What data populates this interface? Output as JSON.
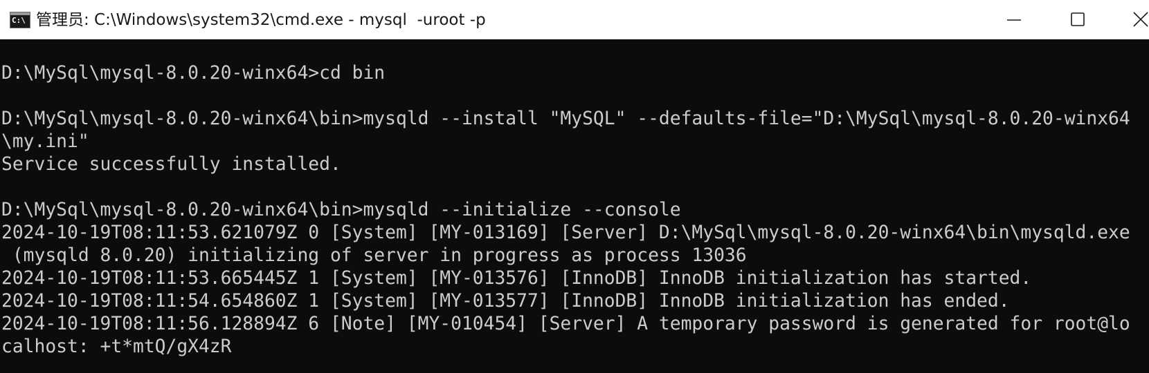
{
  "window": {
    "title": "管理员: C:\\Windows\\system32\\cmd.exe - mysql  -uroot -p",
    "icon_label": "C:\\",
    "icon": "cmd-console-icon",
    "controls": {
      "minimize_icon": "minimize-icon",
      "maximize_icon": "maximize-icon",
      "close_icon": "close-icon"
    }
  },
  "colors": {
    "terminal_background": "#0c0c0c",
    "terminal_text": "#cccccc",
    "titlebar_background": "#ffffff",
    "titlebar_text": "#1a1a1a"
  },
  "terminal": {
    "lines": [
      "D:\\MySql\\mysql-8.0.20-winx64>cd bin",
      "",
      "D:\\MySql\\mysql-8.0.20-winx64\\bin>mysqld --install \"MySQL\" --defaults-file=\"D:\\MySql\\mysql-8.0.20-winx64",
      "\\my.ini\"",
      "Service successfully installed.",
      "",
      "D:\\MySql\\mysql-8.0.20-winx64\\bin>mysqld --initialize --console",
      "2024-10-19T08:11:53.621079Z 0 [System] [MY-013169] [Server] D:\\MySql\\mysql-8.0.20-winx64\\bin\\mysqld.exe",
      " (mysqld 8.0.20) initializing of server in progress as process 13036",
      "2024-10-19T08:11:53.665445Z 1 [System] [MY-013576] [InnoDB] InnoDB initialization has started.",
      "2024-10-19T08:11:54.654860Z 1 [System] [MY-013577] [InnoDB] InnoDB initialization has ended.",
      "2024-10-19T08:11:56.128894Z 6 [Note] [MY-010454] [Server] A temporary password is generated for root@lo",
      "calhost: +t*mtQ/gX4zR"
    ]
  }
}
